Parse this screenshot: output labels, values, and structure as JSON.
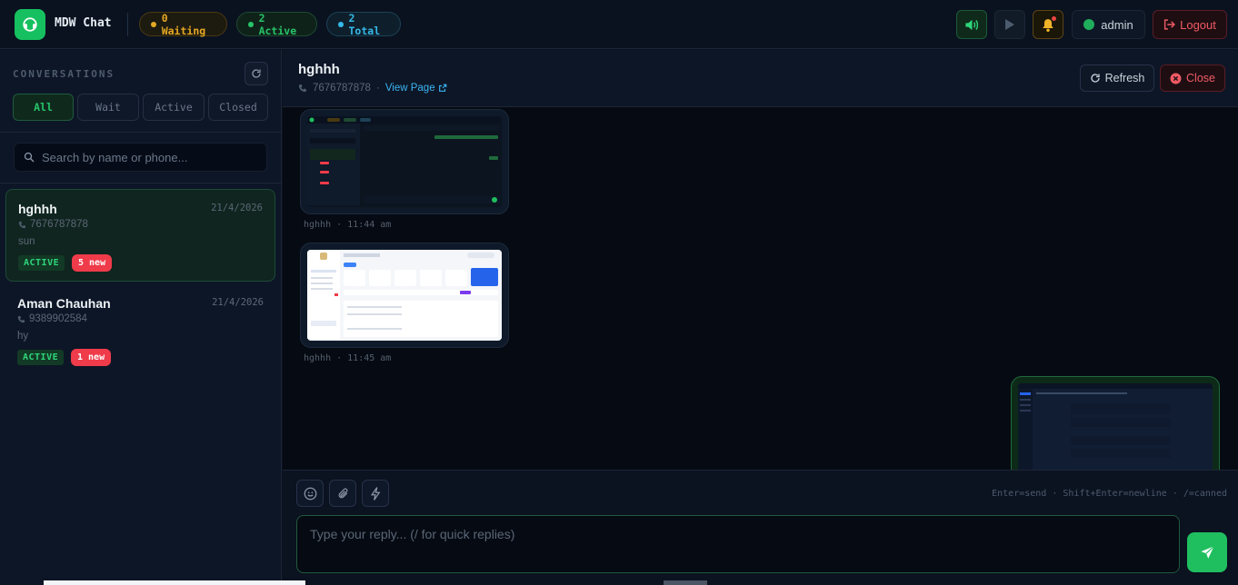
{
  "app": {
    "title": "MDW Chat"
  },
  "stats": {
    "waiting": "0 Waiting",
    "active": "2 Active",
    "total": "2 Total"
  },
  "topbar": {
    "user": "admin",
    "logout": "Logout"
  },
  "sidebar": {
    "heading": "CONVERSATIONS",
    "filters": [
      "All",
      "Wait",
      "Active",
      "Closed"
    ],
    "search_placeholder": "Search by name or phone..."
  },
  "conversations": [
    {
      "name": "hghhh",
      "date": "21/4/2026",
      "phone": "7676787878",
      "message": "sun",
      "status": "ACTIVE",
      "unread": "5 new"
    },
    {
      "name": "Aman Chauhan",
      "date": "21/4/2026",
      "phone": "9389902584",
      "message": "hy",
      "status": "ACTIVE",
      "unread": "1 new"
    }
  ],
  "chat": {
    "name": "hghhh",
    "phone": "7676787878",
    "separator": "·",
    "view_page": "View Page",
    "refresh": "Refresh",
    "close": "Close",
    "messages": [
      {
        "direction": "incoming",
        "type": "image",
        "meta": "hghhh · 11:44 am"
      },
      {
        "direction": "incoming",
        "type": "image",
        "meta": "hghhh · 11:45 am"
      },
      {
        "direction": "outgoing",
        "type": "image",
        "meta": ""
      }
    ]
  },
  "composer": {
    "hints": "Enter=send · Shift+Enter=newline · /=canned",
    "placeholder": "Type your reply... (/ for quick replies)"
  },
  "colors": {
    "accent": "#1fbf5f",
    "danger": "#ef3b4a",
    "warning": "#e5a823",
    "info": "#35b8e8"
  },
  "icons": [
    "headset-icon",
    "speaker-icon",
    "play-icon",
    "bell-icon",
    "user-icon",
    "logout-icon",
    "refresh-icon",
    "search-icon",
    "phone-icon",
    "external-link-icon",
    "close-circle-icon",
    "emoji-icon",
    "paperclip-icon",
    "bolt-icon",
    "send-icon"
  ]
}
